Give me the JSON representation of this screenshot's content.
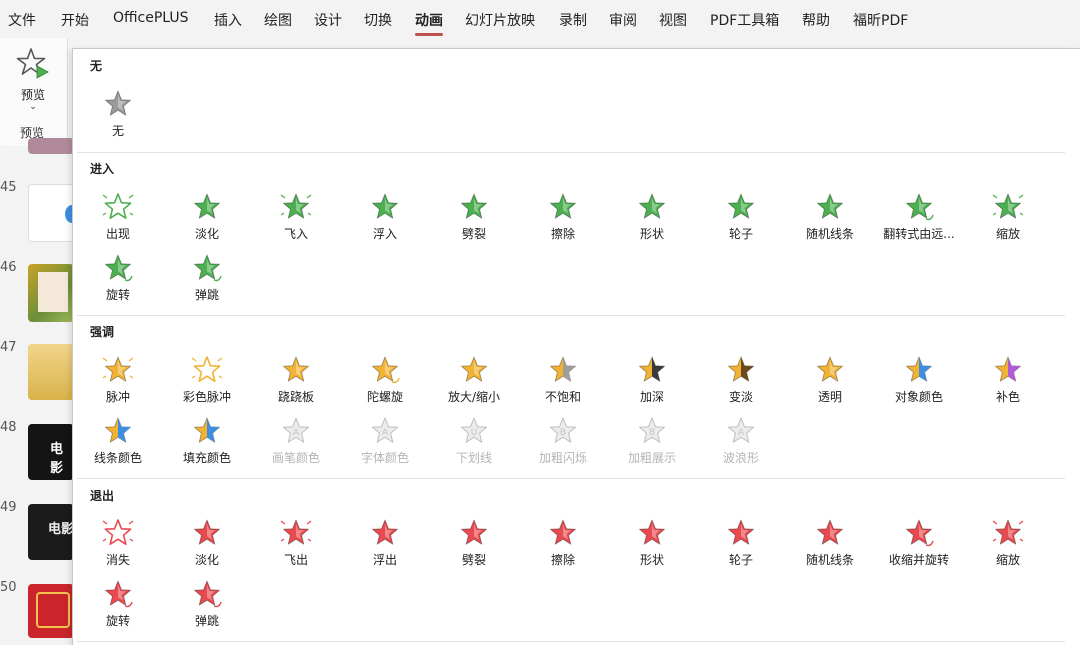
{
  "menu": {
    "tabs": [
      "文件",
      "开始",
      "OfficePLUS",
      "插入",
      "绘图",
      "设计",
      "切换",
      "动画",
      "幻灯片放映",
      "录制",
      "审阅",
      "视图",
      "PDF工具箱",
      "帮助",
      "福昕PDF"
    ],
    "active": "动画"
  },
  "ribbon": {
    "preview_label": "预览",
    "group_label": "预览"
  },
  "slides": {
    "numbers": [
      "45",
      "46",
      "47",
      "48",
      "49",
      "50"
    ],
    "thumb_texts": [
      "电影",
      "电影"
    ]
  },
  "panel": {
    "none_section": {
      "title": "无",
      "items": [
        {
          "label": "无",
          "icon": "star-gray-icon"
        }
      ]
    },
    "entrance": {
      "title": "进入",
      "color": "#4caf50",
      "items": [
        {
          "label": "出现",
          "icon": "appear-icon"
        },
        {
          "label": "淡化",
          "icon": "fade-icon"
        },
        {
          "label": "飞入",
          "icon": "fly-in-icon"
        },
        {
          "label": "浮入",
          "icon": "float-in-icon"
        },
        {
          "label": "劈裂",
          "icon": "split-icon"
        },
        {
          "label": "擦除",
          "icon": "wipe-icon"
        },
        {
          "label": "形状",
          "icon": "shape-icon"
        },
        {
          "label": "轮子",
          "icon": "wheel-icon"
        },
        {
          "label": "随机线条",
          "icon": "random-bars-icon"
        },
        {
          "label": "翻转式由远...",
          "icon": "grow-turn-icon"
        },
        {
          "label": "缩放",
          "icon": "zoom-icon"
        },
        {
          "label": "旋转",
          "icon": "swivel-icon"
        },
        {
          "label": "弹跳",
          "icon": "bounce-icon"
        }
      ]
    },
    "emphasis": {
      "title": "强调",
      "color": "#f2b233",
      "items": [
        {
          "label": "脉冲",
          "icon": "pulse-icon",
          "disabled": false
        },
        {
          "label": "彩色脉冲",
          "icon": "color-pulse-icon",
          "disabled": false
        },
        {
          "label": "跷跷板",
          "icon": "teeter-icon",
          "disabled": false
        },
        {
          "label": "陀螺旋",
          "icon": "spin-icon",
          "disabled": false
        },
        {
          "label": "放大/缩小",
          "icon": "grow-shrink-icon",
          "disabled": false
        },
        {
          "label": "不饱和",
          "icon": "desaturate-icon",
          "disabled": false
        },
        {
          "label": "加深",
          "icon": "darken-icon",
          "disabled": false
        },
        {
          "label": "变淡",
          "icon": "lighten-icon",
          "disabled": false
        },
        {
          "label": "透明",
          "icon": "transparency-icon",
          "disabled": false
        },
        {
          "label": "对象颜色",
          "icon": "object-color-icon",
          "disabled": false
        },
        {
          "label": "补色",
          "icon": "complementary-color-icon",
          "disabled": false
        },
        {
          "label": "线条颜色",
          "icon": "line-color-icon",
          "disabled": false
        },
        {
          "label": "填充颜色",
          "icon": "fill-color-icon",
          "disabled": false
        },
        {
          "label": "画笔颜色",
          "icon": "brush-color-icon",
          "disabled": true
        },
        {
          "label": "字体颜色",
          "icon": "font-color-icon",
          "disabled": true
        },
        {
          "label": "下划线",
          "icon": "underline-icon",
          "disabled": true
        },
        {
          "label": "加粗闪烁",
          "icon": "bold-flash-icon",
          "disabled": true
        },
        {
          "label": "加粗展示",
          "icon": "bold-reveal-icon",
          "disabled": true
        },
        {
          "label": "波浪形",
          "icon": "wave-icon",
          "disabled": true
        }
      ]
    },
    "exit": {
      "title": "退出",
      "color": "#e84a4f",
      "items": [
        {
          "label": "消失",
          "icon": "disappear-icon"
        },
        {
          "label": "淡化",
          "icon": "fade-out-icon"
        },
        {
          "label": "飞出",
          "icon": "fly-out-icon"
        },
        {
          "label": "浮出",
          "icon": "float-out-icon"
        },
        {
          "label": "劈裂",
          "icon": "split-out-icon"
        },
        {
          "label": "擦除",
          "icon": "wipe-out-icon"
        },
        {
          "label": "形状",
          "icon": "shape-out-icon"
        },
        {
          "label": "轮子",
          "icon": "wheel-out-icon"
        },
        {
          "label": "随机线条",
          "icon": "random-bars-out-icon"
        },
        {
          "label": "收缩并旋转",
          "icon": "shrink-turn-icon"
        },
        {
          "label": "缩放",
          "icon": "zoom-out-icon"
        },
        {
          "label": "旋转",
          "icon": "swivel-out-icon"
        },
        {
          "label": "弹跳",
          "icon": "bounce-out-icon"
        }
      ]
    }
  }
}
